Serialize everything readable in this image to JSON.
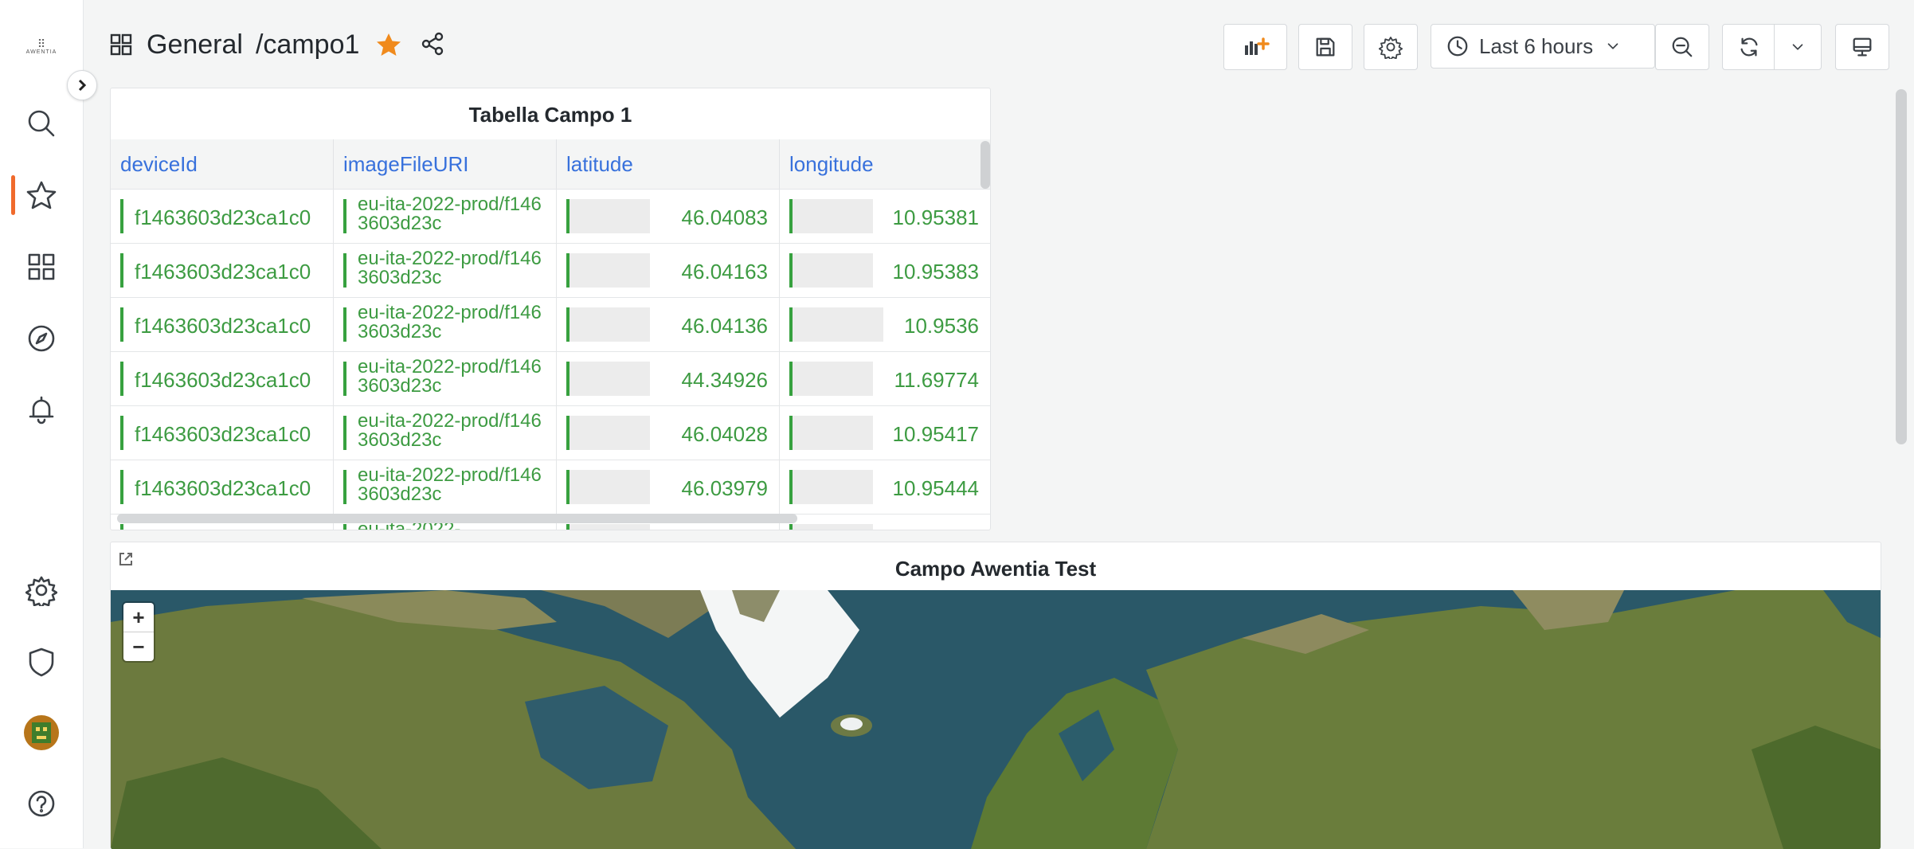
{
  "brand": {
    "name": "AWENTIA"
  },
  "nav": {
    "items": [
      {
        "icon": "search-icon"
      },
      {
        "icon": "star-icon",
        "active": true
      },
      {
        "icon": "dashboards-icon"
      },
      {
        "icon": "explore-icon"
      },
      {
        "icon": "alerting-icon"
      },
      {
        "icon": "gear-icon"
      },
      {
        "icon": "shield-icon"
      },
      {
        "icon": "help-icon"
      }
    ],
    "accent": "#f06a2c"
  },
  "breadcrumb": {
    "folder": "General",
    "separator": "/",
    "dashboard": "campo1"
  },
  "toolbar": {
    "time_range": "Last 6 hours"
  },
  "table_panel": {
    "title": "Tabella Campo 1",
    "columns": [
      "deviceId",
      "imageFileURI",
      "latitude",
      "longitude"
    ],
    "rows": [
      {
        "deviceId": "f1463603d23ca1c0",
        "imageFileURI": "eu-ita-2022-prod/f1463603d23c",
        "latitude": "46.04083",
        "longitude": "10.95381",
        "lat_fill": 0.46,
        "lon_fill": 0.46
      },
      {
        "deviceId": "f1463603d23ca1c0",
        "imageFileURI": "eu-ita-2022-prod/f1463603d23c",
        "latitude": "46.04163",
        "longitude": "10.95383",
        "lat_fill": 0.46,
        "lon_fill": 0.46
      },
      {
        "deviceId": "f1463603d23ca1c0",
        "imageFileURI": "eu-ita-2022-prod/f1463603d23c",
        "latitude": "46.04136",
        "longitude": "10.9536",
        "lat_fill": 0.46,
        "lon_fill": 0.52
      },
      {
        "deviceId": "f1463603d23ca1c0",
        "imageFileURI": "eu-ita-2022-prod/f1463603d23c",
        "latitude": "44.34926",
        "longitude": "11.69774",
        "lat_fill": 0.46,
        "lon_fill": 0.46
      },
      {
        "deviceId": "f1463603d23ca1c0",
        "imageFileURI": "eu-ita-2022-prod/f1463603d23c",
        "latitude": "46.04028",
        "longitude": "10.95417",
        "lat_fill": 0.46,
        "lon_fill": 0.46
      },
      {
        "deviceId": "f1463603d23ca1c0",
        "imageFileURI": "eu-ita-2022-prod/f1463603d23c",
        "latitude": "46.03979",
        "longitude": "10.95444",
        "lat_fill": 0.46,
        "lon_fill": 0.46
      },
      {
        "deviceId": "",
        "imageFileURI": "eu-ita-2022-",
        "latitude": "",
        "longitude": "",
        "lat_fill": 0.46,
        "lon_fill": 0.46
      }
    ],
    "value_color": "#3d9b42",
    "header_color": "#3871dc"
  },
  "map_panel": {
    "title": "Campo Awentia Test",
    "zoom_in": "+",
    "zoom_out": "−"
  }
}
